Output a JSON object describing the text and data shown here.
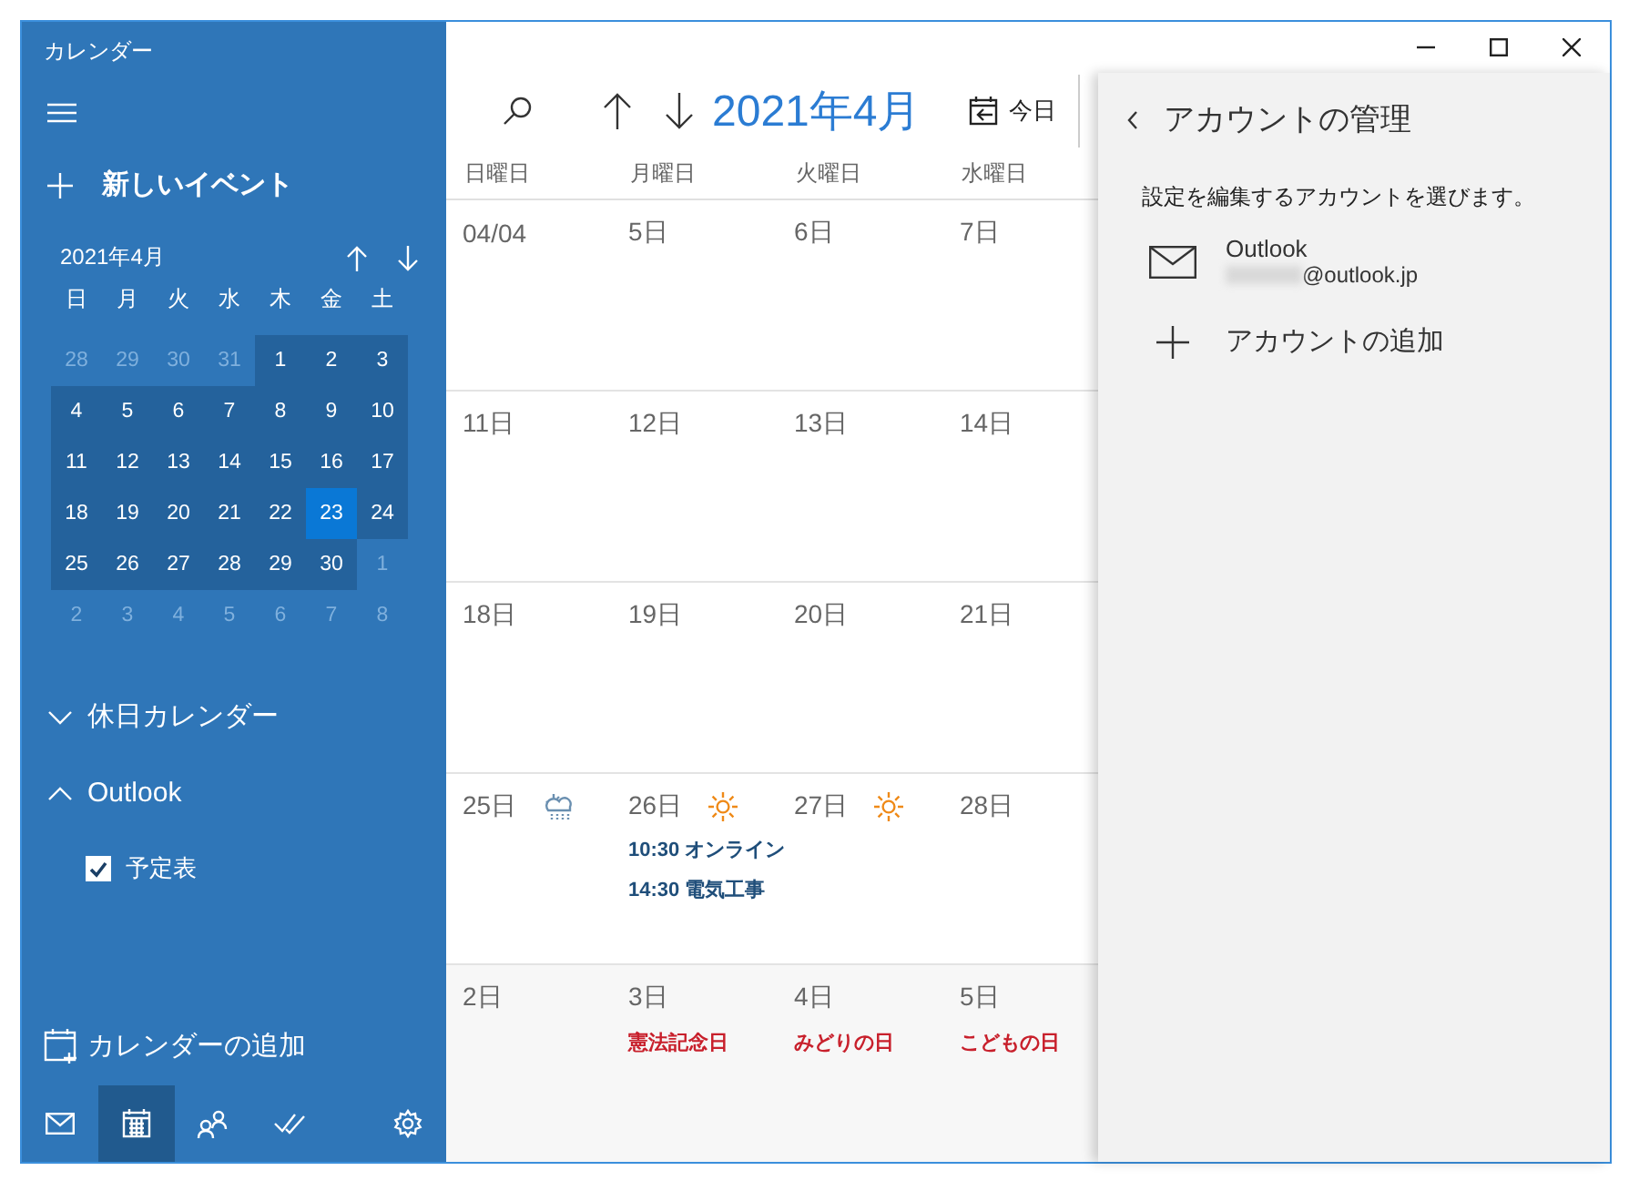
{
  "window": {
    "title": "カレンダー"
  },
  "sidebar": {
    "new_event": "新しいイベント",
    "mini_calendar": {
      "title": "2021年4月",
      "weekdays": [
        "日",
        "月",
        "火",
        "水",
        "木",
        "金",
        "土"
      ],
      "weeks": [
        [
          {
            "day": "28",
            "in_month": false,
            "selected": false
          },
          {
            "day": "29",
            "in_month": false,
            "selected": false
          },
          {
            "day": "30",
            "in_month": false,
            "selected": false
          },
          {
            "day": "31",
            "in_month": false,
            "selected": false
          },
          {
            "day": "1",
            "in_month": true,
            "selected": false
          },
          {
            "day": "2",
            "in_month": true,
            "selected": false
          },
          {
            "day": "3",
            "in_month": true,
            "selected": false
          }
        ],
        [
          {
            "day": "4",
            "in_month": true,
            "selected": false
          },
          {
            "day": "5",
            "in_month": true,
            "selected": false
          },
          {
            "day": "6",
            "in_month": true,
            "selected": false
          },
          {
            "day": "7",
            "in_month": true,
            "selected": false
          },
          {
            "day": "8",
            "in_month": true,
            "selected": false
          },
          {
            "day": "9",
            "in_month": true,
            "selected": false
          },
          {
            "day": "10",
            "in_month": true,
            "selected": false
          }
        ],
        [
          {
            "day": "11",
            "in_month": true,
            "selected": false
          },
          {
            "day": "12",
            "in_month": true,
            "selected": false
          },
          {
            "day": "13",
            "in_month": true,
            "selected": false
          },
          {
            "day": "14",
            "in_month": true,
            "selected": false
          },
          {
            "day": "15",
            "in_month": true,
            "selected": false
          },
          {
            "day": "16",
            "in_month": true,
            "selected": false
          },
          {
            "day": "17",
            "in_month": true,
            "selected": false
          }
        ],
        [
          {
            "day": "18",
            "in_month": true,
            "selected": false
          },
          {
            "day": "19",
            "in_month": true,
            "selected": false
          },
          {
            "day": "20",
            "in_month": true,
            "selected": false
          },
          {
            "day": "21",
            "in_month": true,
            "selected": false
          },
          {
            "day": "22",
            "in_month": true,
            "selected": false
          },
          {
            "day": "23",
            "in_month": true,
            "selected": true
          },
          {
            "day": "24",
            "in_month": true,
            "selected": false
          }
        ],
        [
          {
            "day": "25",
            "in_month": true,
            "selected": false
          },
          {
            "day": "26",
            "in_month": true,
            "selected": false
          },
          {
            "day": "27",
            "in_month": true,
            "selected": false
          },
          {
            "day": "28",
            "in_month": true,
            "selected": false
          },
          {
            "day": "29",
            "in_month": true,
            "selected": false
          },
          {
            "day": "30",
            "in_month": true,
            "selected": false
          },
          {
            "day": "1",
            "in_month": false,
            "selected": false
          }
        ],
        [
          {
            "day": "2",
            "in_month": false,
            "selected": false
          },
          {
            "day": "3",
            "in_month": false,
            "selected": false
          },
          {
            "day": "4",
            "in_month": false,
            "selected": false
          },
          {
            "day": "5",
            "in_month": false,
            "selected": false
          },
          {
            "day": "6",
            "in_month": false,
            "selected": false
          },
          {
            "day": "7",
            "in_month": false,
            "selected": false
          },
          {
            "day": "8",
            "in_month": false,
            "selected": false
          }
        ]
      ]
    },
    "groups": [
      {
        "label": "休日カレンダー",
        "expanded": false
      },
      {
        "label": "Outlook",
        "expanded": true,
        "calendars": [
          {
            "label": "予定表",
            "checked": true
          }
        ]
      }
    ],
    "add_calendar": "カレンダーの追加",
    "nav": [
      {
        "kind": "mail",
        "selected": false
      },
      {
        "kind": "calendar",
        "selected": true
      },
      {
        "kind": "people",
        "selected": false
      },
      {
        "kind": "todo",
        "selected": false
      },
      {
        "kind": "settings",
        "selected": false
      }
    ]
  },
  "toolbar": {
    "month": "2021年4月",
    "today": "今日"
  },
  "grid": {
    "weekdays": [
      "日曜日",
      "月曜日",
      "火曜日",
      "水曜日"
    ],
    "weeks": [
      {
        "other_month": false,
        "days": [
          {
            "label": "04/04"
          },
          {
            "label": "5日"
          },
          {
            "label": "6日"
          },
          {
            "label": "7日"
          }
        ]
      },
      {
        "other_month": false,
        "days": [
          {
            "label": "11日"
          },
          {
            "label": "12日"
          },
          {
            "label": "13日"
          },
          {
            "label": "14日"
          }
        ]
      },
      {
        "other_month": false,
        "days": [
          {
            "label": "18日"
          },
          {
            "label": "19日"
          },
          {
            "label": "20日"
          },
          {
            "label": "21日"
          }
        ]
      },
      {
        "other_month": false,
        "days": [
          {
            "label": "25日",
            "weather": {
              "kind": "cloud-rain"
            }
          },
          {
            "label": "26日",
            "weather": {
              "kind": "sun"
            },
            "items": [
              {
                "kind": "event",
                "text": "10:30 オンライン"
              },
              {
                "kind": "event",
                "text": "14:30 電気工事"
              }
            ]
          },
          {
            "label": "27日",
            "weather": {
              "kind": "sun"
            }
          },
          {
            "label": "28日"
          }
        ]
      },
      {
        "other_month": true,
        "days": [
          {
            "label": "2日"
          },
          {
            "label": "3日",
            "items": [
              {
                "kind": "holiday",
                "text": "憲法記念日"
              }
            ]
          },
          {
            "label": "4日",
            "items": [
              {
                "kind": "holiday",
                "text": "みどりの日"
              }
            ]
          },
          {
            "label": "5日",
            "items": [
              {
                "kind": "holiday",
                "text": "こどもの日"
              }
            ]
          }
        ]
      }
    ]
  },
  "account_panel": {
    "title": "アカウントの管理",
    "prompt": "設定を編集するアカウントを選びます。",
    "accounts": [
      {
        "name": "Outlook",
        "email": "@outlook.jp"
      }
    ],
    "add_account": "アカウントの追加"
  }
}
